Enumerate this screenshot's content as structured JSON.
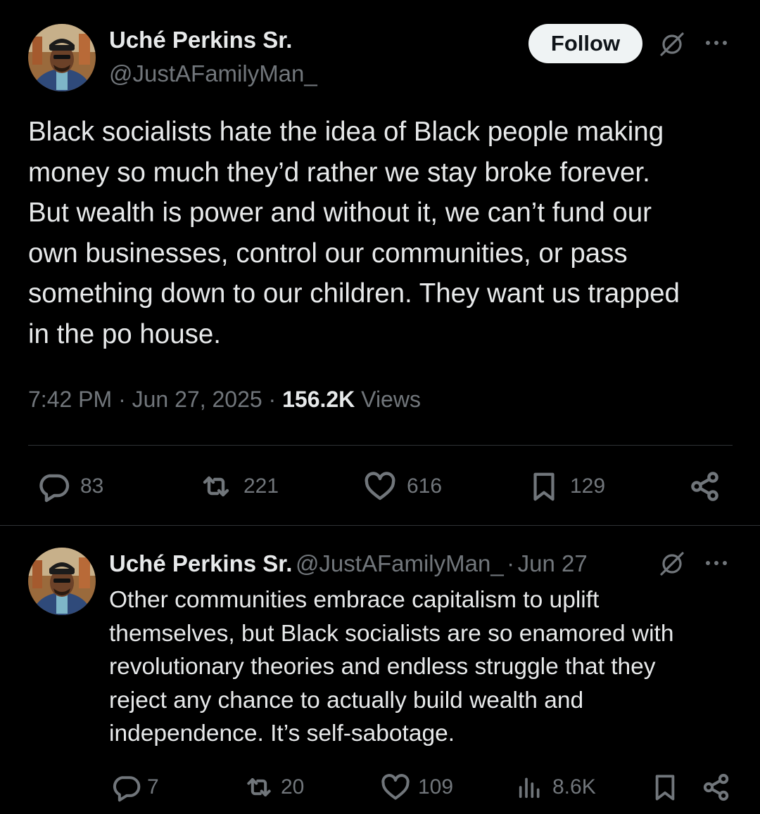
{
  "main_tweet": {
    "author_name": "Uché Perkins Sr.",
    "author_handle": "@JustAFamilyMan_",
    "follow_label": "Follow",
    "text_lines": [
      "Black socialists hate the idea of Black people making",
      "money so much they’d rather we stay broke forever.",
      "But wealth is power and without it, we can’t fund our",
      "own businesses, control our communities, or pass",
      "something down to our children. They want us trapped",
      "in the po house."
    ],
    "time": "7:42 PM",
    "separator": "·",
    "date": "Jun 27, 2025",
    "views_count": "156.2K",
    "views_label": "Views",
    "replies": "83",
    "reposts": "221",
    "likes": "616",
    "bookmarks": "129"
  },
  "reply_tweet": {
    "author_name": "Uché Perkins Sr.",
    "author_handle": "@JustAFamilyMan_",
    "separator": "·",
    "date": "Jun 27",
    "text_lines": [
      "Other communities embrace capitalism to uplift",
      "themselves, but Black socialists are so enamored with",
      "revolutionary theories and endless struggle that they",
      "reject any chance to actually build wealth and",
      "independence. It’s self-sabotage."
    ],
    "replies": "7",
    "reposts": "20",
    "likes": "109",
    "views": "8.6K"
  },
  "colors": {
    "background": "#000000",
    "text_primary": "#e7e9ea",
    "text_secondary": "#71767b",
    "divider": "#2f3336",
    "follow_button_bg": "#eff3f4"
  },
  "icons": [
    "grok-icon",
    "more-icon",
    "reply-icon",
    "repost-icon",
    "like-icon",
    "bookmark-icon",
    "share-icon",
    "views-icon"
  ]
}
